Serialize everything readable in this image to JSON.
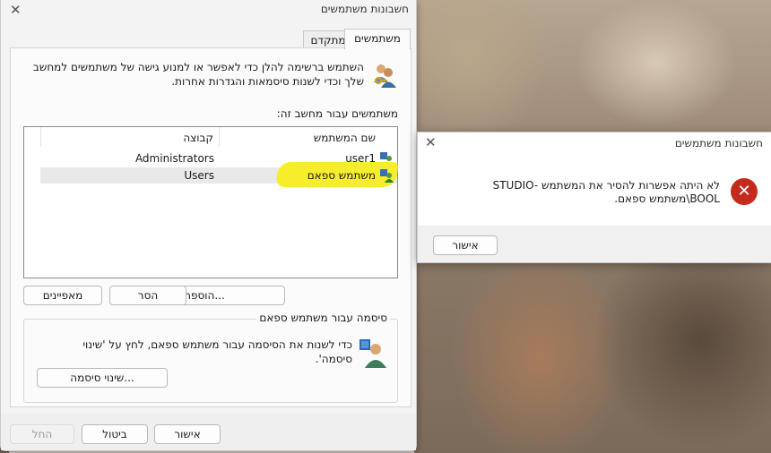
{
  "main_dialog": {
    "title": "חשבונות משתמשים",
    "tabs": [
      {
        "label": "משתמשים",
        "active": true
      },
      {
        "label": "מתקדם",
        "active": false
      }
    ],
    "intro_text": "השתמש ברשימה להלן כדי לאפשר או למנוע גישה של משתמשים למחשב שלך וכדי לשנות סיסמאות והגדרות אחרות.",
    "list_label": "משתמשים עבור מחשב זה:",
    "columns": {
      "user": "שם המשתמש",
      "group": "קבוצה"
    },
    "rows": [
      {
        "user": "user1",
        "group": "Administrators",
        "selected": false
      },
      {
        "user": "משתמש ספאם",
        "group": "Users",
        "selected": true
      }
    ],
    "buttons": {
      "add": "הוספה...",
      "remove": "הסר",
      "properties": "מאפיינים"
    },
    "password_group": {
      "legend": "סיסמה עבור משתמש ספאם",
      "text": "כדי לשנות את הסיסמה עבור משתמש ספאם, לחץ על 'שינוי סיסמה'.",
      "change_button": "שינוי סיסמה..."
    },
    "footer": {
      "ok": "אישור",
      "cancel": "ביטול",
      "apply": "החל"
    }
  },
  "error_dialog": {
    "title": "חשבונות משתמשים",
    "message": "לא היתה אפשרות להסיר את המשתמש STUDIO-BOOL\\משתמש ספאם.",
    "ok": "אישור"
  },
  "colors": {
    "highlight": "#f6ee2a",
    "error_red": "#c42b1c",
    "window_bg": "#f3f3f3"
  }
}
